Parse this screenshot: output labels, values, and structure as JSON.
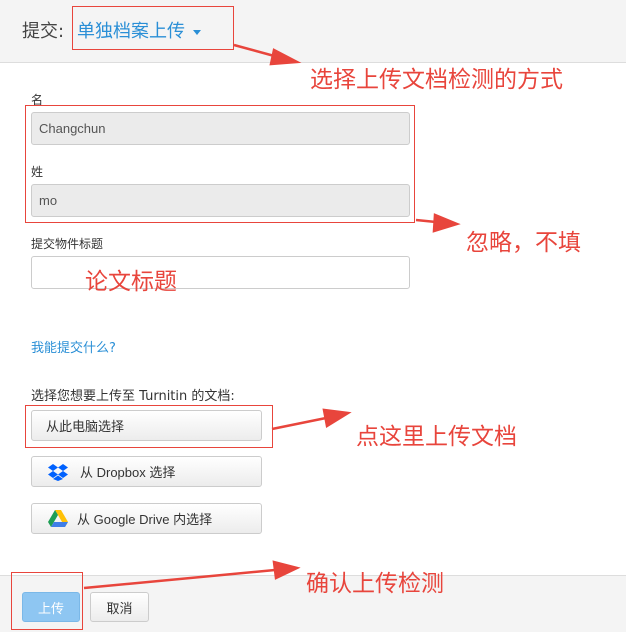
{
  "header": {
    "title": "提交:",
    "mode_label": "单独档案上传"
  },
  "form": {
    "first_name": {
      "label": "名",
      "value": "Changchun"
    },
    "last_name": {
      "label": "姓",
      "value": "mo"
    },
    "submission_title": {
      "label": "提交物件标题",
      "placeholder": "",
      "value": ""
    },
    "help_link": "我能提交什么?",
    "upload_prompt": "选择您想要上传至 Turnitin 的文档:",
    "upload_buttons": {
      "computer": "从此电脑选择",
      "dropbox": "从 Dropbox 选择",
      "google_drive": "从 Google Drive 内选择"
    }
  },
  "footer": {
    "submit_label": "上传",
    "cancel_label": "取消"
  },
  "annotations": {
    "choose_method": "选择上传文档检测的方式",
    "ignore": "忽略，不填",
    "title_hint": "论文标题",
    "upload_here": "点这里上传文档",
    "confirm": "确认上传检测"
  },
  "colors": {
    "accent": "#2a8fd6",
    "annotation": "#e8453c",
    "primary_button": "#8ec6f2"
  }
}
